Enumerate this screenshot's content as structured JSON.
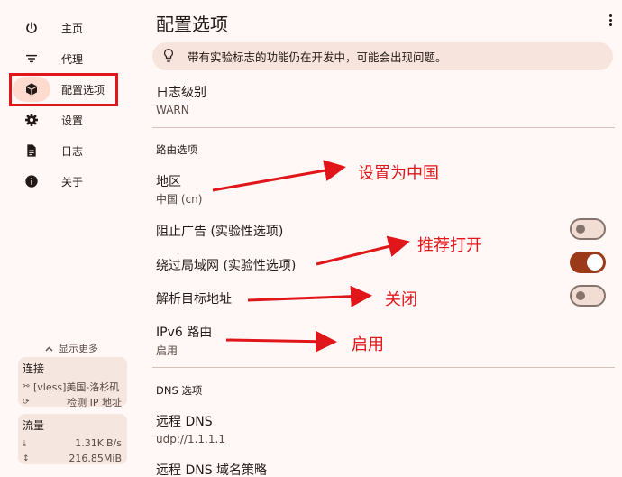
{
  "sidebar": {
    "items": [
      {
        "label": "主页",
        "icon": "power-icon"
      },
      {
        "label": "代理",
        "icon": "filter-list-icon"
      },
      {
        "label": "配置选项",
        "icon": "box-icon"
      },
      {
        "label": "设置",
        "icon": "gear-icon"
      },
      {
        "label": "日志",
        "icon": "document-icon"
      },
      {
        "label": "关于",
        "icon": "info-icon"
      }
    ],
    "show_more": "显示更多",
    "connection": {
      "title": "连接",
      "profile": "[vless]美国-洛杉矶",
      "check_ip": "检测 IP 地址"
    },
    "traffic": {
      "title": "流量",
      "speed": "1.31KiB/s",
      "total": "216.85MiB"
    }
  },
  "main": {
    "title": "配置选项",
    "banner": "带有实验标志的功能仍在开发中，可能会出现问题。",
    "log_level": {
      "label": "日志级别",
      "value": "WARN"
    },
    "routing": {
      "section": "路由选项",
      "region": {
        "label": "地区",
        "value": "中国 (cn)"
      },
      "block_ads": {
        "label": "阻止广告 (实验性选项)",
        "enabled": false
      },
      "bypass_lan": {
        "label": "绕过局域网 (实验性选项)",
        "enabled": true
      },
      "resolve_dest": {
        "label": "解析目标地址",
        "enabled": false
      },
      "ipv6": {
        "label": "IPv6 路由",
        "value": "启用"
      }
    },
    "dns": {
      "section": "DNS 选项",
      "remote_dns": {
        "label": "远程 DNS",
        "value": "udp://1.1.1.1"
      },
      "remote_strategy": {
        "label": "远程 DNS 域名策略"
      }
    }
  },
  "annotations": {
    "region_note": "设置为中国",
    "bypass_note": "推荐打开",
    "resolve_note": "关闭",
    "ipv6_note": "启用",
    "color": "#e0161b"
  },
  "colors": {
    "background": "#fff8f6",
    "accent": "#9b3a1a",
    "active_nav": "#ffdbcf"
  }
}
